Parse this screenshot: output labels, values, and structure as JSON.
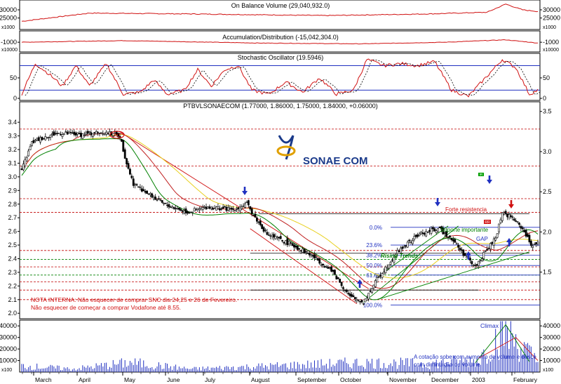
{
  "panels": {
    "obv": {
      "title": "On Balance Volume (29,040,932.0)",
      "scale_label": "x1000",
      "ticks": [
        {
          "v": 30000,
          "label": "30000"
        },
        {
          "v": 25000,
          "label": "25000"
        }
      ],
      "range": [
        18000,
        36000
      ],
      "color": "#d01010"
    },
    "ad": {
      "title": "Accumulation/Distribution (-15,042,304.0)",
      "scale_label": "x10000",
      "ticks": [
        {
          "v": -1000,
          "label": "-1000"
        }
      ],
      "range": [
        -1600,
        -300
      ],
      "color": "#d01010"
    },
    "stoch": {
      "title": "Stochastic Oscillator (19.5946)",
      "ticks": [
        {
          "v": 50,
          "label": "50"
        },
        {
          "v": 0,
          "label": "0"
        }
      ],
      "range": [
        -5,
        110
      ],
      "levels": [
        80,
        20
      ],
      "line_color": "#d01010",
      "level_color": "#2030c0"
    },
    "price": {
      "title": "PTBVLSONAECOM (1.77000, 1.86000, 1.75000, 1.84000, +0.06000)",
      "range": [
        1.96,
        3.55
      ],
      "left_ticks": [
        {
          "v": 3.4,
          "label": "3.4"
        },
        {
          "v": 3.3,
          "label": "3.3"
        },
        {
          "v": 3.2,
          "label": "3.2"
        },
        {
          "v": 3.1,
          "label": "3.1"
        },
        {
          "v": 3.0,
          "label": "3.0"
        },
        {
          "v": 2.9,
          "label": "2.9"
        },
        {
          "v": 2.8,
          "label": "2.8"
        },
        {
          "v": 2.7,
          "label": "2.7"
        },
        {
          "v": 2.6,
          "label": "2.6"
        },
        {
          "v": 2.5,
          "label": "2.5"
        },
        {
          "v": 2.4,
          "label": "2.4"
        },
        {
          "v": 2.3,
          "label": "2.3"
        },
        {
          "v": 2.2,
          "label": "2.2"
        },
        {
          "v": 2.1,
          "label": "2.1"
        },
        {
          "v": 2.0,
          "label": "2.0"
        }
      ],
      "right_ticks": [
        {
          "v": 3.5,
          "label": "3.5"
        },
        {
          "v": 3.0,
          "label": "3.0"
        },
        {
          "v": 2.5,
          "label": "2.5"
        },
        {
          "v": 2.0,
          "label": "2.0"
        },
        {
          "v": 1.5,
          "label": "1.5"
        }
      ],
      "right_range": [
        0.92,
        3.62
      ],
      "logo_text": "SONAE COM",
      "fib_levels": [
        {
          "label": "0.0%",
          "v": 2.63
        },
        {
          "label": "23.6%",
          "v": 2.5
        },
        {
          "label": "38.2%",
          "v": 2.425
        },
        {
          "label": "50.0%",
          "v": 2.35
        },
        {
          "label": "61.8%",
          "v": 2.28
        },
        {
          "label": "100.0%",
          "v": 2.06
        }
      ],
      "annotations": {
        "nota_line1": "NOTA INTERNA: Não esquecer de comprar SNC dia 24,25 e 26  de Fevereiro.",
        "nota_line2": "Não esquecer de começar a comprar Vodafone até 8.55.",
        "forte_resistencia": "Forte resistencia",
        "suporte": "Suporte importante",
        "gap": "GAP",
        "rising_trends": "Rising Trends",
        "ac_marker": "AC",
        "ir_marker": "IR",
        "rr_marker": "RR"
      },
      "candle_color_up": "#ffffff",
      "candle_color_down": "#000000"
    },
    "volume": {
      "scale_label": "x100",
      "ticks": [
        {
          "v": 40000,
          "label": "40000"
        },
        {
          "v": 30000,
          "label": "30000"
        },
        {
          "v": 20000,
          "label": "20000"
        },
        {
          "v": 10000,
          "label": "10000"
        }
      ],
      "range": [
        0,
        45000
      ],
      "climax_label": "Climax",
      "note_line1": "A cotação sobe com  aumento de volume e desce",
      "note_line2": "com diminuição de volume"
    }
  },
  "chart_data": {
    "type": "candlestick",
    "months": [
      "March",
      "April",
      "May",
      "June",
      "July",
      "August",
      "September",
      "October",
      "November",
      "December",
      "2003",
      "February"
    ],
    "price_keypoints": [
      {
        "i": 0,
        "p": 3.05
      },
      {
        "i": 6,
        "p": 3.25
      },
      {
        "i": 15,
        "p": 3.3
      },
      {
        "i": 22,
        "p": 3.32
      },
      {
        "i": 35,
        "p": 3.31
      },
      {
        "i": 48,
        "p": 3.33
      },
      {
        "i": 58,
        "p": 3.3
      },
      {
        "i": 62,
        "p": 3.1
      },
      {
        "i": 66,
        "p": 2.95
      },
      {
        "i": 72,
        "p": 2.9
      },
      {
        "i": 84,
        "p": 2.8
      },
      {
        "i": 98,
        "p": 2.74
      },
      {
        "i": 110,
        "p": 2.78
      },
      {
        "i": 125,
        "p": 2.76
      },
      {
        "i": 133,
        "p": 2.8
      },
      {
        "i": 138,
        "p": 2.7
      },
      {
        "i": 145,
        "p": 2.58
      },
      {
        "i": 160,
        "p": 2.5
      },
      {
        "i": 172,
        "p": 2.42
      },
      {
        "i": 184,
        "p": 2.3
      },
      {
        "i": 194,
        "p": 2.12
      },
      {
        "i": 202,
        "p": 2.08
      },
      {
        "i": 210,
        "p": 2.25
      },
      {
        "i": 222,
        "p": 2.45
      },
      {
        "i": 235,
        "p": 2.58
      },
      {
        "i": 246,
        "p": 2.62
      },
      {
        "i": 254,
        "p": 2.55
      },
      {
        "i": 262,
        "p": 2.42
      },
      {
        "i": 268,
        "p": 2.34
      },
      {
        "i": 274,
        "p": 2.45
      },
      {
        "i": 280,
        "p": 2.55
      },
      {
        "i": 284,
        "p": 2.74
      },
      {
        "i": 290,
        "p": 2.7
      },
      {
        "i": 296,
        "p": 2.62
      },
      {
        "i": 301,
        "p": 2.5
      },
      {
        "i": 305,
        "p": 2.52
      }
    ],
    "volume_keypoints": [
      {
        "i": 0,
        "v": 6000
      },
      {
        "i": 30,
        "v": 3000
      },
      {
        "i": 64,
        "v": 9000
      },
      {
        "i": 100,
        "v": 3000
      },
      {
        "i": 150,
        "v": 6000
      },
      {
        "i": 200,
        "v": 9000
      },
      {
        "i": 240,
        "v": 8000
      },
      {
        "i": 270,
        "v": 12000
      },
      {
        "i": 286,
        "v": 42000
      },
      {
        "i": 295,
        "v": 25000
      },
      {
        "i": 305,
        "v": 10000
      }
    ],
    "obv_keypoints": [
      {
        "i": 0,
        "v": 23000
      },
      {
        "i": 40,
        "v": 28000
      },
      {
        "i": 100,
        "v": 27500
      },
      {
        "i": 180,
        "v": 26500
      },
      {
        "i": 240,
        "v": 27500
      },
      {
        "i": 275,
        "v": 28500
      },
      {
        "i": 286,
        "v": 33500
      },
      {
        "i": 296,
        "v": 30000
      },
      {
        "i": 305,
        "v": 29000
      }
    ],
    "ad_keypoints": [
      {
        "i": 0,
        "v": -1000
      },
      {
        "i": 60,
        "v": -900
      },
      {
        "i": 140,
        "v": -1050
      },
      {
        "i": 200,
        "v": -1100
      },
      {
        "i": 250,
        "v": -1000
      },
      {
        "i": 286,
        "v": -850
      },
      {
        "i": 305,
        "v": -1050
      }
    ],
    "stoch_keypoints": [
      {
        "i": 0,
        "v": 10
      },
      {
        "i": 8,
        "v": 85
      },
      {
        "i": 16,
        "v": 60
      },
      {
        "i": 24,
        "v": 30
      },
      {
        "i": 32,
        "v": 80
      },
      {
        "i": 40,
        "v": 30
      },
      {
        "i": 50,
        "v": 85
      },
      {
        "i": 60,
        "v": 10
      },
      {
        "i": 70,
        "v": 15
      },
      {
        "i": 78,
        "v": 45
      },
      {
        "i": 86,
        "v": 10
      },
      {
        "i": 96,
        "v": 20
      },
      {
        "i": 104,
        "v": 70
      },
      {
        "i": 112,
        "v": 30
      },
      {
        "i": 120,
        "v": 70
      },
      {
        "i": 128,
        "v": 80
      },
      {
        "i": 136,
        "v": 20
      },
      {
        "i": 146,
        "v": 10
      },
      {
        "i": 156,
        "v": 40
      },
      {
        "i": 166,
        "v": 15
      },
      {
        "i": 176,
        "v": 50
      },
      {
        "i": 186,
        "v": 10
      },
      {
        "i": 196,
        "v": 20
      },
      {
        "i": 204,
        "v": 95
      },
      {
        "i": 214,
        "v": 80
      },
      {
        "i": 224,
        "v": 85
      },
      {
        "i": 234,
        "v": 80
      },
      {
        "i": 244,
        "v": 90
      },
      {
        "i": 254,
        "v": 20
      },
      {
        "i": 264,
        "v": 5
      },
      {
        "i": 274,
        "v": 50
      },
      {
        "i": 284,
        "v": 95
      },
      {
        "i": 292,
        "v": 75
      },
      {
        "i": 300,
        "v": 10
      },
      {
        "i": 305,
        "v": 20
      }
    ]
  }
}
